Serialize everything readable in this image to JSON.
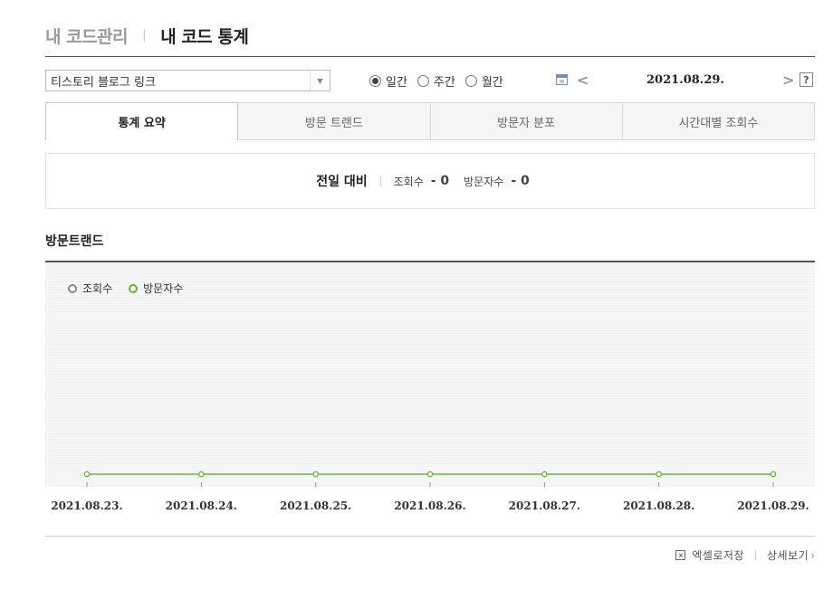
{
  "breadcrumb": {
    "parent": "내 코드관리",
    "current": "내 코드 통계"
  },
  "site_select": {
    "selected": "티스토리 블로그 링크"
  },
  "period": {
    "options": [
      "일간",
      "주간",
      "월간"
    ],
    "selected": "일간"
  },
  "date_nav": {
    "date": "2021.08.29.",
    "help_label": "?"
  },
  "tabs": [
    "통계 요약",
    "방문 트랜드",
    "방문자 분포",
    "시간대별 조회수"
  ],
  "active_tab": "통계 요약",
  "summary": {
    "label": "전일 대비",
    "views_label": "조회수",
    "views_value": "- 0",
    "visitors_label": "방문자수",
    "visitors_value": "- 0"
  },
  "trend": {
    "title": "방문트랜드"
  },
  "footer": {
    "excel_label": "엑셀로저장",
    "detail_label": "상세보기"
  },
  "colors": {
    "views_series": "#7f8c98",
    "visitors_series": "#5bbd2e"
  },
  "chart_data": {
    "type": "line",
    "x": [
      "2021.08.23.",
      "2021.08.24.",
      "2021.08.25.",
      "2021.08.26.",
      "2021.08.27.",
      "2021.08.28.",
      "2021.08.29."
    ],
    "series": [
      {
        "name": "조회수",
        "values": [
          0,
          0,
          0,
          0,
          0,
          0,
          0
        ]
      },
      {
        "name": "방문자수",
        "values": [
          0,
          0,
          0,
          0,
          0,
          0,
          0
        ]
      }
    ],
    "legend": "top-left",
    "grid": false
  }
}
